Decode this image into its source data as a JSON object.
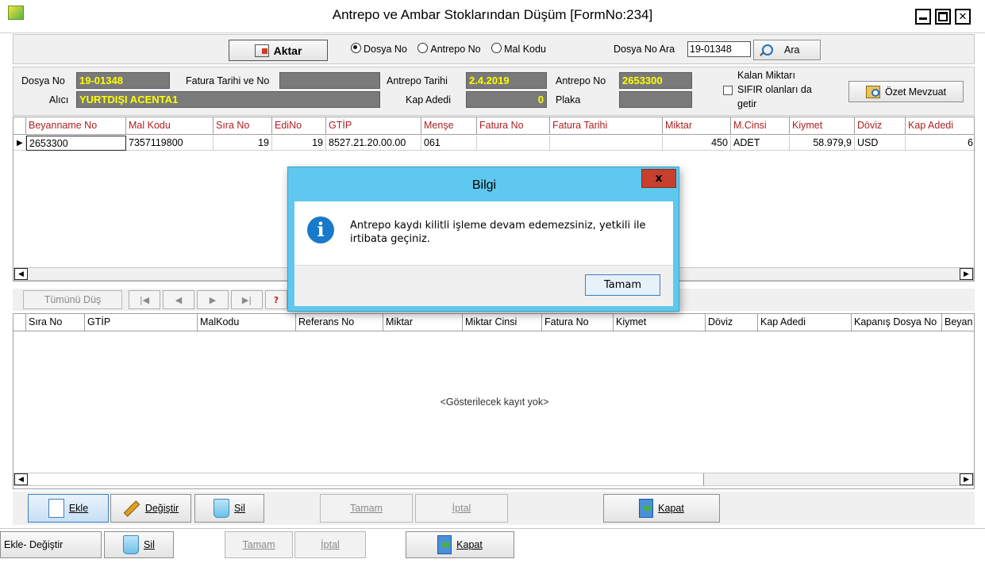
{
  "window": {
    "title": "Antrepo ve Ambar Stoklarından Düşüm [FormNo:234]",
    "min_glyph": "▬",
    "max_glyph": "▢",
    "close_glyph": "✕"
  },
  "toolbar": {
    "transfer_button": "Aktar",
    "radio_options": [
      "Dosya No",
      "Antrepo No",
      "Mal Kodu"
    ],
    "selected_radio": "Dosya No",
    "search_label": "Dosya No Ara",
    "search_value": "19-01348",
    "search_button": "Ara"
  },
  "form": {
    "dosya_no_label": "Dosya No",
    "dosya_no": "19-01348",
    "fatura_label": "Fatura Tarihi ve No",
    "fatura_value": "",
    "antrepo_tarihi_label": "Antrepo Tarihi",
    "antrepo_tarihi": "2.4.2019",
    "antrepo_no_label": "Antrepo No",
    "antrepo_no": "2653300",
    "alici_label": "Alıcı",
    "alici": "YURTDIŞI ACENTA1",
    "kap_adedi_label": "Kap Adedi",
    "kap_adedi": "0",
    "plaka_label": "Plaka",
    "plaka": "",
    "kalan_line1": "Kalan Miktarı",
    "kalan_line2": "SIFIR olanları da",
    "kalan_line3": "getir",
    "ozet_button": "Özet Mevzuat"
  },
  "grid1": {
    "headers": [
      "Beyanname No",
      "Mal Kodu",
      "Sıra No",
      "EdiNo",
      "GTİP",
      "Menşe",
      "Fatura No",
      "Fatura Tarihi",
      "Miktar",
      "M.Cinsi",
      "Kiymet",
      "Döviz",
      "Kap Adedi"
    ],
    "rows": [
      [
        "2653300",
        "7357119800",
        "19",
        "19",
        "8527.21.20.00.00",
        "061",
        "",
        "",
        "450",
        "ADET",
        "58.979,9",
        "USD",
        "6"
      ]
    ]
  },
  "grid2": {
    "tumunu_dus": "Tümünü Düş",
    "headers": [
      "Sıra No",
      "GTİP",
      "MalKodu",
      "Referans No",
      "Miktar",
      "Miktar Cinsi",
      "Fatura No",
      "Kiymet",
      "Döviz",
      "Kap Adedi",
      "Kapanış Dosya No",
      "Beyan"
    ],
    "empty_text": "<Gösterilecek kayıt yok>"
  },
  "bottom_bar": {
    "ekle": "Ekle",
    "degistir": "Değiştir",
    "sil": "Sil",
    "tamam": "Tamam",
    "iptal": "İptal",
    "kapat": "Kapat"
  },
  "outer_bar": {
    "ekle_degistir": "Ekle- Değiştir",
    "sil": "Sil",
    "tamam": "Tamam",
    "iptal": "İptal",
    "kapat": "Kapat"
  },
  "dialog": {
    "title": "Bilgi",
    "message": "Antrepo kaydı kilitli işleme devam edemezsiniz, yetkili ile irtibata geçiniz.",
    "ok_button": "Tamam",
    "close_glyph": "x"
  },
  "colors": {
    "field_bg": "#7a7a7a",
    "field_text": "#ffff00",
    "dialog_title_bg": "#5fc8ee",
    "info_icon": "#1979ca"
  }
}
